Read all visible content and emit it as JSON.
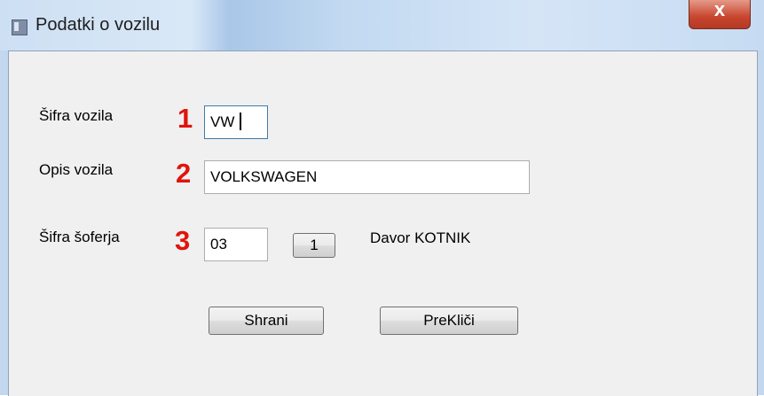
{
  "window": {
    "title": "Podatki o vozilu",
    "close_symbol": "x",
    "title_icon": "window-app-icon"
  },
  "form": {
    "vehicle_code": {
      "label": "Šifra vozila",
      "marker": "1",
      "value": "VW"
    },
    "vehicle_description": {
      "label": "Opis vozila",
      "marker": "2",
      "value": "VOLKSWAGEN"
    },
    "driver_code": {
      "label": "Šifra šoferja",
      "marker": "3",
      "value": "03",
      "lookup_button": "1",
      "driver_name": "Davor KOTNIK"
    }
  },
  "buttons": {
    "save": "Shrani",
    "cancel": "PreKliči"
  },
  "colors": {
    "marker": "#e0140c",
    "titlebar": "#c2d9f1",
    "client_bg": "#f0f0f0",
    "close_button": "#c8452e"
  }
}
